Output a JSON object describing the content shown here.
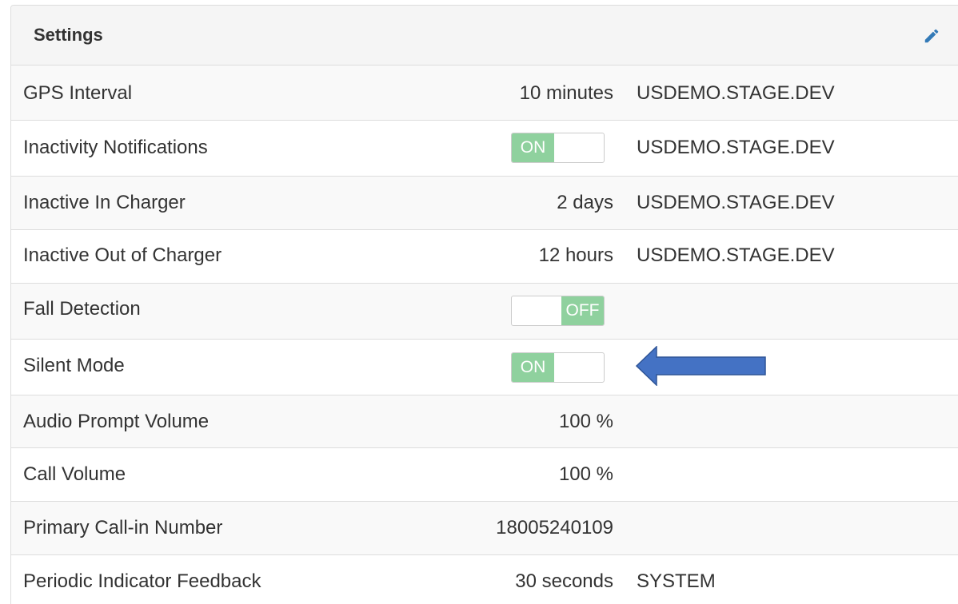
{
  "panel": {
    "title": "Settings",
    "edit_icon": "pencil-icon"
  },
  "rows": [
    {
      "label": "GPS Interval",
      "value": "10 minutes",
      "source": "USDEMO.STAGE.DEV"
    },
    {
      "label": "Inactivity Notifications",
      "toggle": "ON",
      "source": "USDEMO.STAGE.DEV"
    },
    {
      "label": "Inactive In Charger",
      "value": "2 days",
      "source": "USDEMO.STAGE.DEV"
    },
    {
      "label": "Inactive Out of Charger",
      "value": "12 hours",
      "source": "USDEMO.STAGE.DEV"
    },
    {
      "label": "Fall Detection",
      "toggle": "OFF",
      "source": ""
    },
    {
      "label": "Silent Mode",
      "toggle": "ON",
      "source": ""
    },
    {
      "label": "Audio Prompt Volume",
      "value": "100 %",
      "source": ""
    },
    {
      "label": "Call Volume",
      "value": "100 %",
      "source": ""
    },
    {
      "label": "Primary Call-in Number",
      "value": "18005240109",
      "source": ""
    },
    {
      "label": "Periodic Indicator Feedback",
      "value": "30 seconds",
      "source": "SYSTEM"
    }
  ],
  "annotation": {
    "arrow_icon": "left-arrow-icon",
    "arrow_color": "#4472c4"
  },
  "colors": {
    "toggle_active": "#8fd19e",
    "edit_icon": "#337ab7"
  }
}
